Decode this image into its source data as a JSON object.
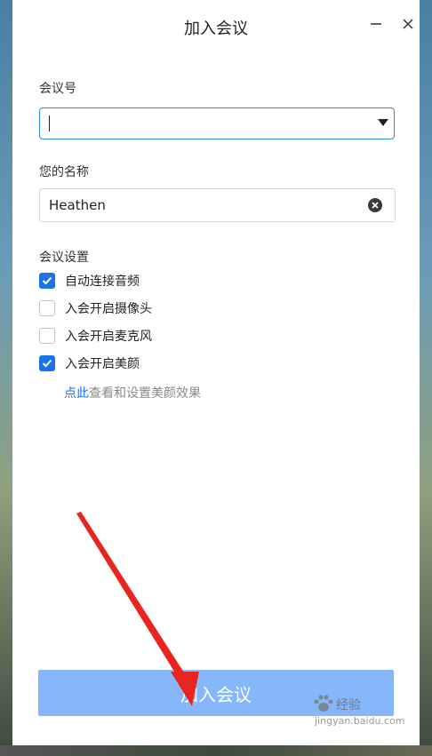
{
  "window": {
    "title": "加入会议"
  },
  "meeting_id": {
    "label": "会议号",
    "value": "",
    "placeholder": ""
  },
  "display_name": {
    "label": "您的名称",
    "value": "Heathen"
  },
  "settings": {
    "label": "会议设置",
    "options": [
      {
        "label": "自动连接音频",
        "checked": true
      },
      {
        "label": "入会开启摄像头",
        "checked": false
      },
      {
        "label": "入会开启麦克风",
        "checked": false
      },
      {
        "label": "入会开启美颜",
        "checked": true
      }
    ],
    "hint": {
      "link_text": "点此",
      "text": "查看和设置美颜效果"
    }
  },
  "join_button": {
    "label": "加入会议"
  },
  "watermark": {
    "brand": "经验",
    "url": "jingyan.baidu.com"
  },
  "colors": {
    "accent": "#1a73e8",
    "join_button_bg": "#85b7fa",
    "annotation_arrow": "#e8251e"
  }
}
